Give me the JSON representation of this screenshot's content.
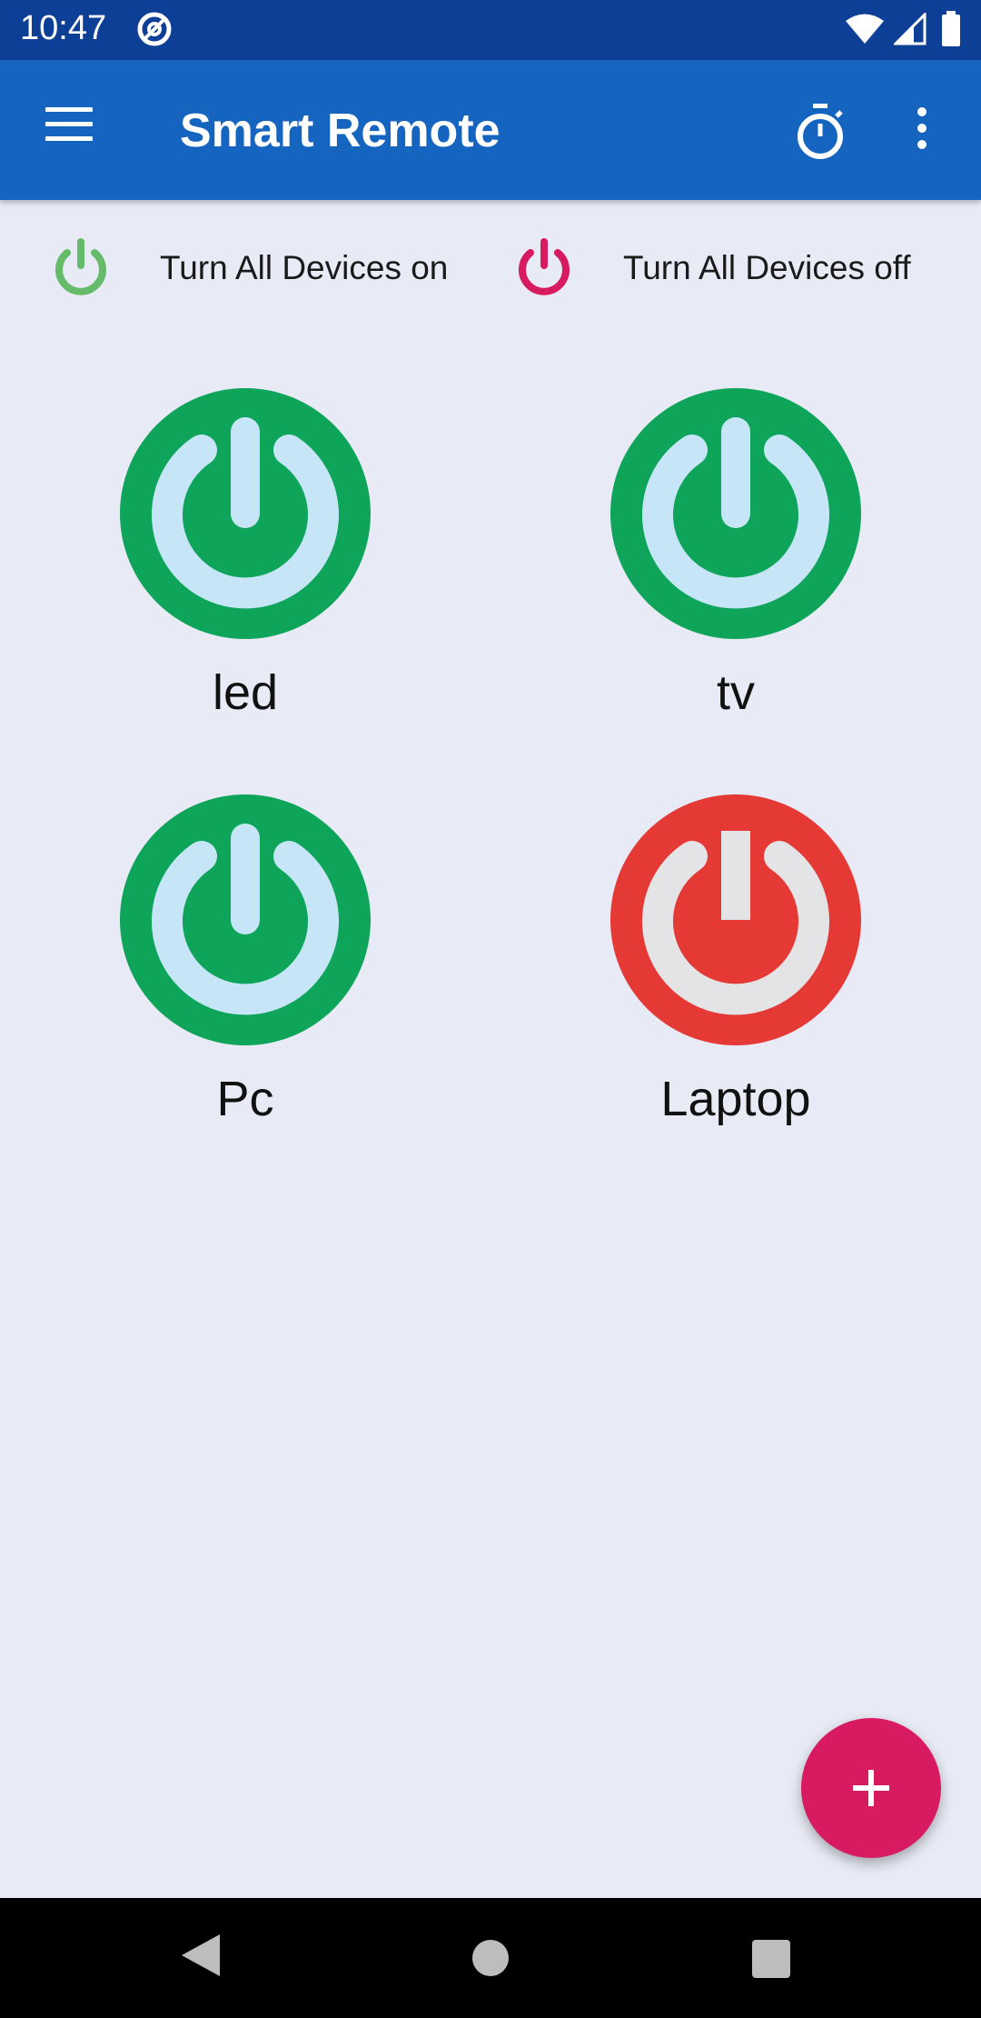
{
  "status_bar": {
    "time": "10:47"
  },
  "app_bar": {
    "title": "Smart Remote"
  },
  "all_devices": {
    "on_label": "Turn All Devices on",
    "off_label": "Turn All Devices off",
    "on_color": "#66bb6a",
    "off_color": "#d81b60"
  },
  "devices": [
    {
      "name": "led",
      "state": "on"
    },
    {
      "name": "tv",
      "state": "on"
    },
    {
      "name": "Pc",
      "state": "on"
    },
    {
      "name": "Laptop",
      "state": "off"
    }
  ],
  "colors": {
    "status_bar": "#0d3f97",
    "app_bar": "#1565c0",
    "background": "#e8eaf6",
    "on": "#0ea55a",
    "off": "#e53935",
    "fab": "#d81b60"
  }
}
